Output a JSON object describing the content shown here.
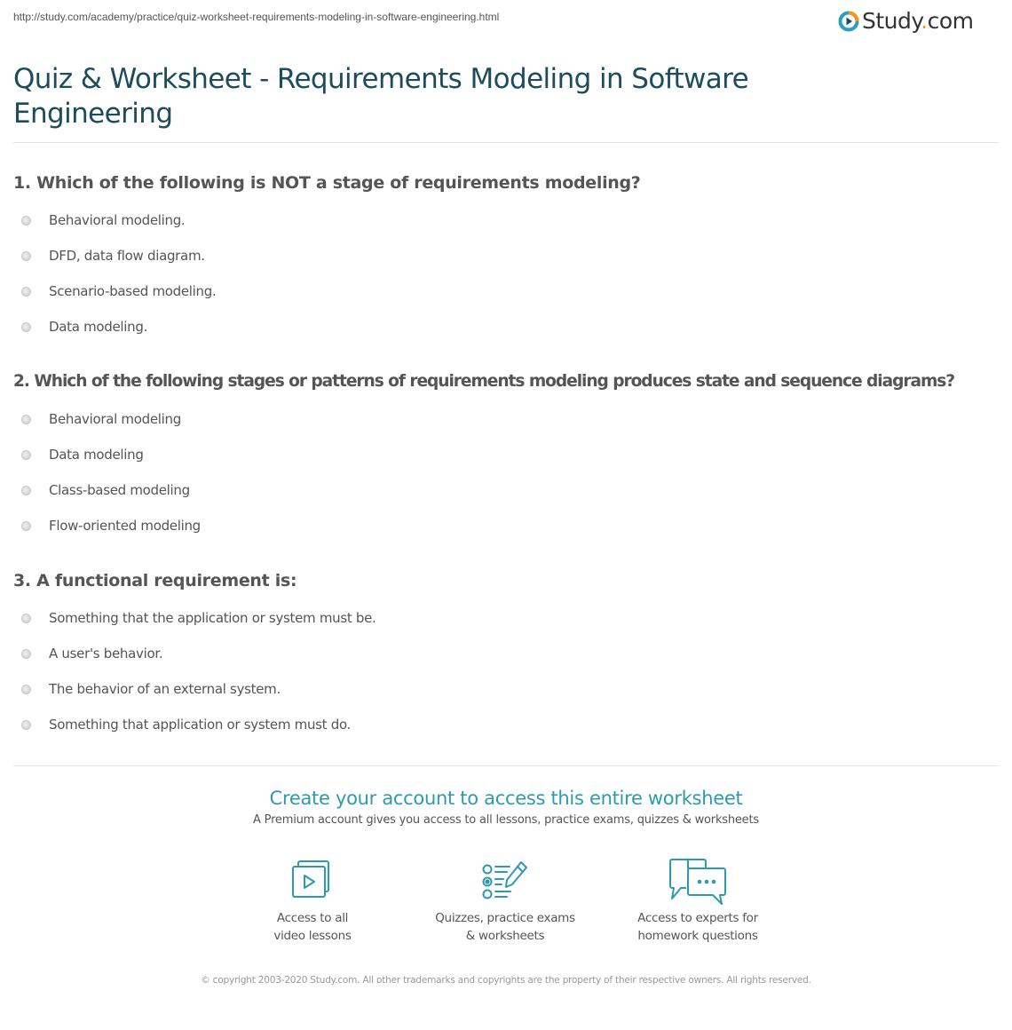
{
  "header": {
    "url": "http://study.com/academy/practice/quiz-worksheet-requirements-modeling-in-software-engineering.html",
    "logo": {
      "name": "Study",
      "dot": ".",
      "tld": "com",
      "icon": "play-circle-icon",
      "colors": {
        "ring_blue": "#2a9fc0",
        "ring_orange": "#f7941d",
        "play": "#1d4c5c"
      }
    }
  },
  "page": {
    "title": "Quiz & Worksheet - Requirements Modeling in Software Engineering"
  },
  "questions": [
    {
      "number": "1.",
      "text": "1. Which of the following is NOT a stage of requirements modeling?",
      "options": [
        "Behavioral modeling.",
        "DFD, data flow diagram.",
        "Scenario-based modeling.",
        "Data modeling."
      ]
    },
    {
      "number": "2.",
      "text": "2. Which of the following stages or patterns of requirements modeling produces state and sequence diagrams?",
      "options": [
        "Behavioral modeling",
        "Data modeling",
        "Class-based modeling",
        "Flow-oriented modeling"
      ]
    },
    {
      "number": "3.",
      "text": "3. A functional requirement is:",
      "options": [
        "Something that the application or system must be.",
        "A user's behavior.",
        "The behavior of an external system.",
        "Something that application or system must do."
      ]
    }
  ],
  "cta": {
    "title": "Create your account to access this entire worksheet",
    "subtitle": "A Premium account gives you access to all lessons, practice exams, quizzes & worksheets",
    "accent_color": "#2e9ab0",
    "features": [
      {
        "icon": "video-lessons-icon",
        "line1": "Access to all",
        "line2": "video lessons"
      },
      {
        "icon": "quiz-checklist-icon",
        "line1": "Quizzes, practice exams",
        "line2": "& worksheets"
      },
      {
        "icon": "chat-bubbles-icon",
        "line1": "Access to experts for",
        "line2": "homework questions"
      }
    ]
  },
  "footer": {
    "copyright": "© copyright 2003-2020 Study.com. All other trademarks and copyrights are the property of their respective owners. All rights reserved."
  }
}
